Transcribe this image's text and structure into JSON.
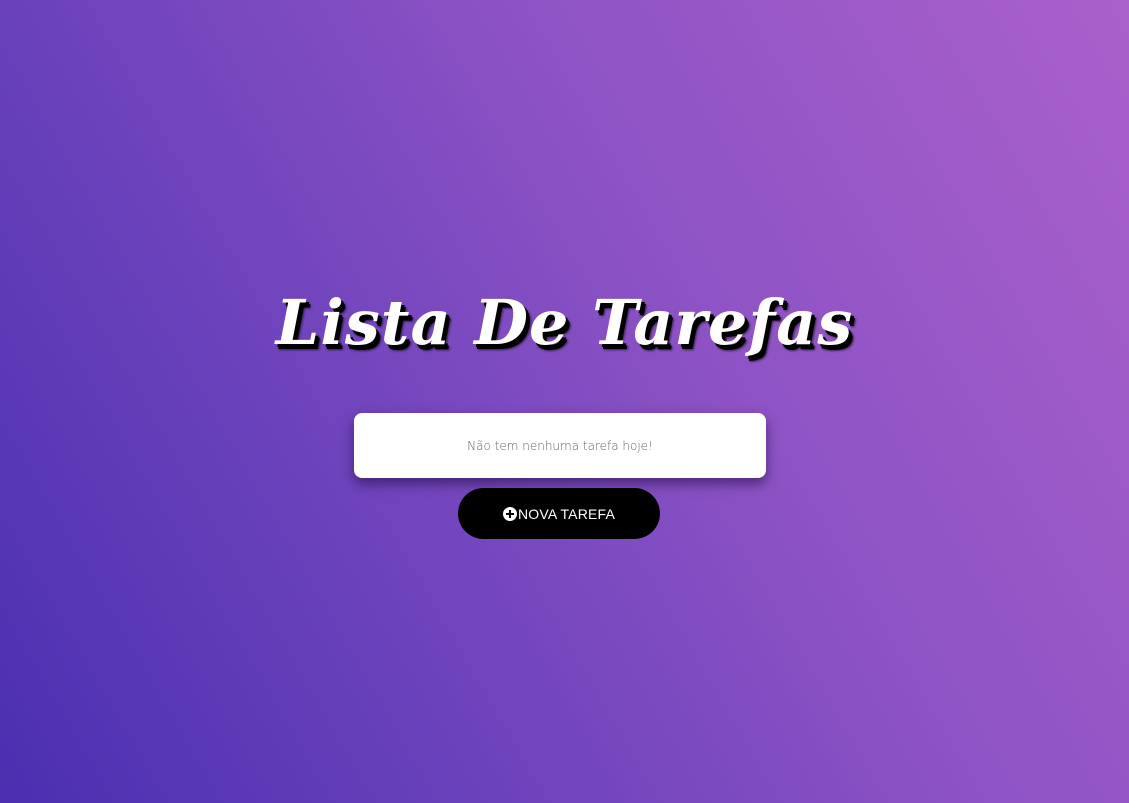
{
  "app": {
    "title": "Lista De Tarefas"
  },
  "task_list": {
    "empty_message": "Não tem nenhuma tarefa hoje!"
  },
  "actions": {
    "new_task_label": "NOVA TAREFA",
    "new_task_icon": "plus-circle-icon"
  },
  "colors": {
    "gradient_start": "#4a2fb0",
    "gradient_end": "#aa60cb",
    "button_bg": "#000000",
    "card_bg": "#ffffff"
  }
}
